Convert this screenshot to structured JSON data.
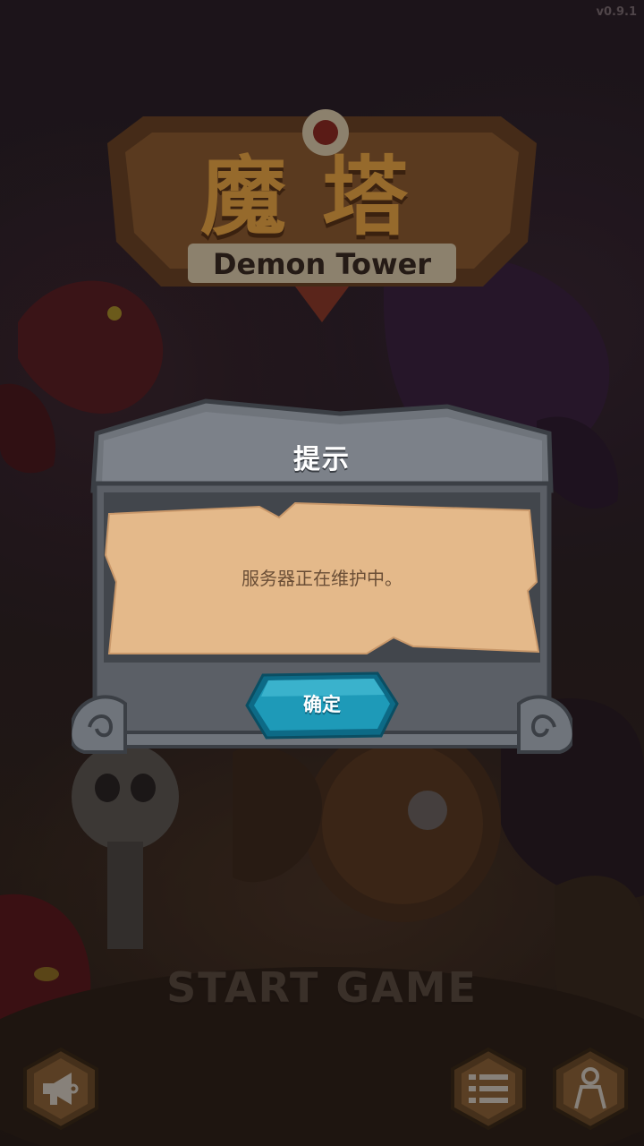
{
  "version": "v0.9.1",
  "logo": {
    "title_cn": "魔塔",
    "title_en": "Demon Tower"
  },
  "main": {
    "start_label": "START GAME"
  },
  "bottom_buttons": [
    {
      "icon": "megaphone-icon"
    },
    {
      "icon": "list-menu-icon"
    },
    {
      "icon": "character-icon"
    }
  ],
  "dialog": {
    "title": "提示",
    "message": "服务器正在维护中。",
    "confirm_label": "确定"
  },
  "colors": {
    "dialog_frame": "#5b5f66",
    "parchment": "#e4b98a",
    "confirm_button": "#1e9ab8"
  }
}
